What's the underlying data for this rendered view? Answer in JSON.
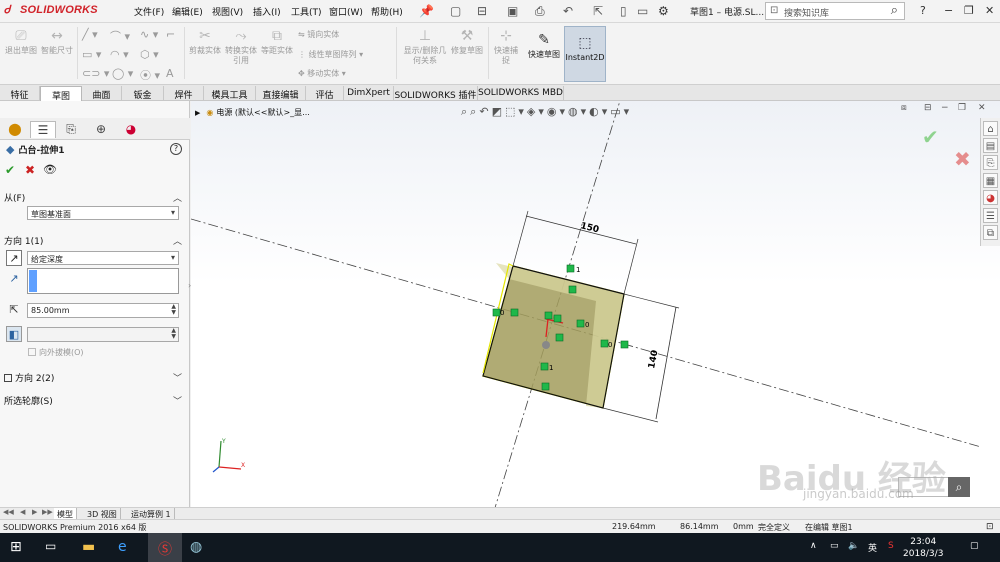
{
  "app": {
    "logo_text": "SOLIDWORKS",
    "doc_title": "草图1 – 电源.SL...",
    "search_placeholder": "搜索知识库"
  },
  "menu": [
    "文件(F)",
    "编辑(E)",
    "视图(V)",
    "插入(I)",
    "工具(T)",
    "窗口(W)",
    "帮助(H)"
  ],
  "ribbon": {
    "exit_sketch": "退出草图",
    "smart_dim": "智能尺寸",
    "trim": "剪裁实体",
    "convert": "转换实体引用",
    "offset": "等距实体",
    "mirror": "镜向实体",
    "linear_pattern": "线性草图阵列",
    "move": "移动实体",
    "display_relations": "显示/删除几何关系",
    "repair": "修复草图",
    "quick_snap": "快速捕捉",
    "rapid_sketch": "快速草图",
    "instant2d": "Instant2D"
  },
  "tabs": [
    "特征",
    "草图",
    "曲面",
    "钣金",
    "焊件",
    "模具工具",
    "直接编辑",
    "评估",
    "DimXpert",
    "SOLIDWORKS 插件",
    "SOLIDWORKS MBD"
  ],
  "active_tab": "草图",
  "property_manager": {
    "title": "凸台-拉伸1",
    "help": "?",
    "from_label": "从(F)",
    "from_value": "草图基准面",
    "dir1_label": "方向 1(1)",
    "dir1_type": "给定深度",
    "depth_value": "85.00mm",
    "draft_outward": "向外拔模(O)",
    "dir2_label": "方向 2(2)",
    "contours_label": "所选轮廓(S)"
  },
  "graphics": {
    "breadcrumb": "电源 (默认<<默认>_显...",
    "dims": [
      "150",
      "140"
    ],
    "relation_tags": [
      "1",
      "0",
      "0",
      "1",
      "0"
    ],
    "watermark_brand": "Baidu 经验",
    "watermark_url": "jingyan.baidu.com"
  },
  "bottom_tabs": [
    "模型",
    "3D 视图",
    "运动算例 1"
  ],
  "status": {
    "product": "SOLIDWORKS Premium 2016 x64 版",
    "x": "219.64mm",
    "y": "86.14mm",
    "z": "0mm",
    "state": "完全定义",
    "editing": "在编辑 草图1"
  },
  "taskbar": {
    "ime": "英",
    "time": "23:04",
    "date": "2018/3/3"
  }
}
